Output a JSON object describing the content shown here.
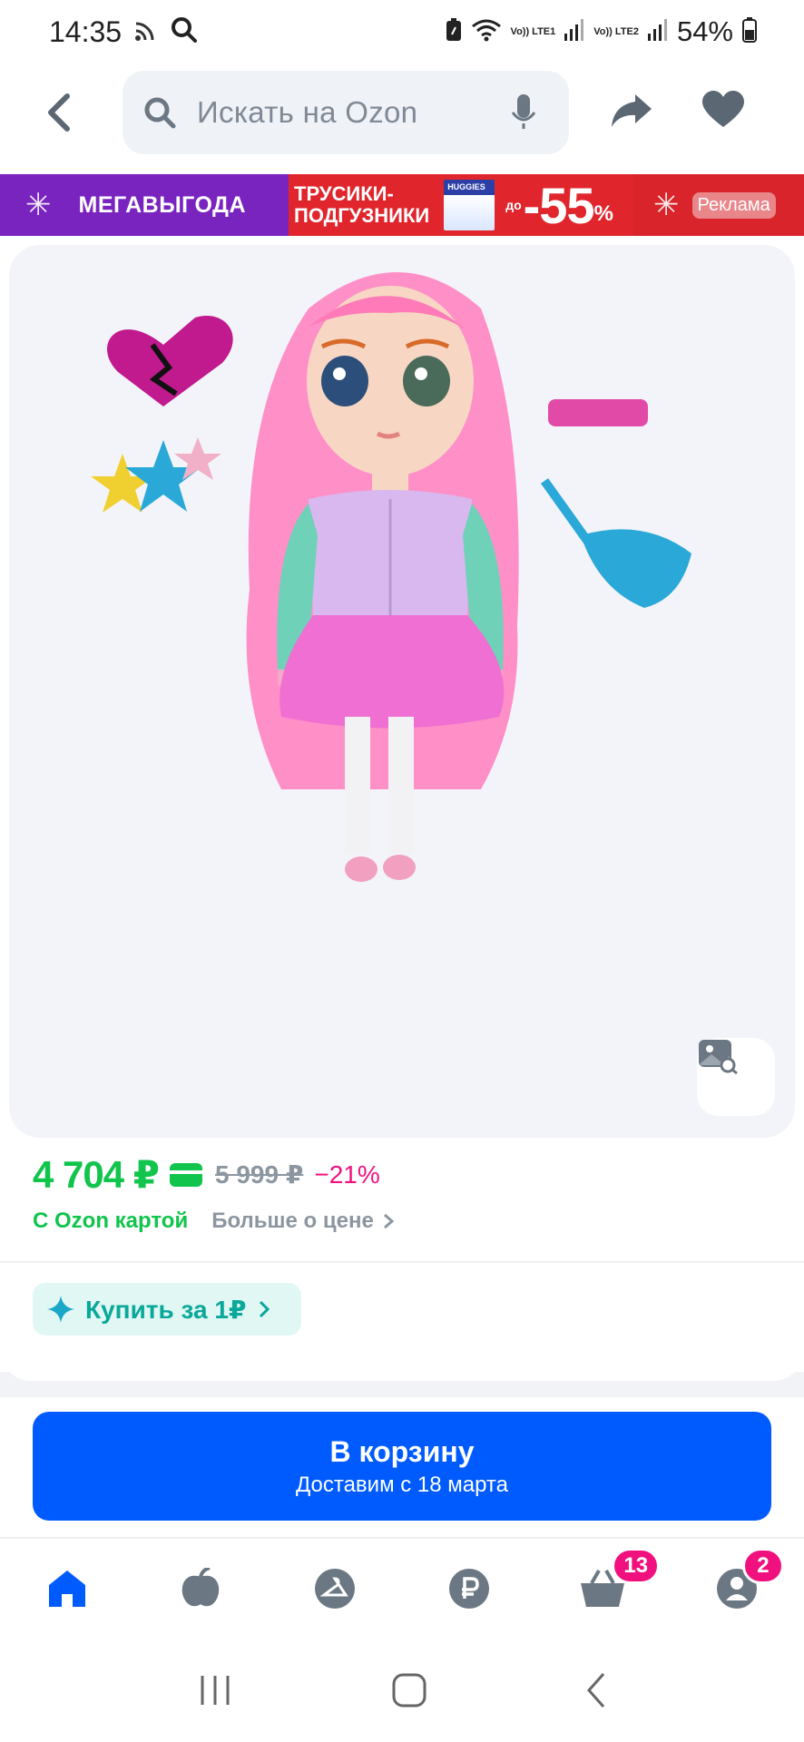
{
  "status_bar": {
    "time": "14:35",
    "battery": "54%",
    "sim1": "Vo)) LTE1",
    "sim2": "Vo)) LTE2"
  },
  "header": {
    "search_placeholder": "Искать на Ozon"
  },
  "banner": {
    "title": "МЕГАВЫГОДА",
    "product_line1": "ТРУСИКИ-",
    "product_line2": "ПОДГУЗНИКИ",
    "pack_brand": "HUGGIES",
    "prefix": "до",
    "discount": "-55",
    "percent": "%",
    "ad_label": "Реклама"
  },
  "price": {
    "current": "4 704 ₽",
    "old": "5 999 ₽",
    "discount": "−21%",
    "card_note": "С Ozon картой",
    "more_link": "Больше о цене"
  },
  "promo": {
    "buy_for_1": "Купить за 1₽"
  },
  "cart_button": {
    "title": "В корзину",
    "subtitle": "Доставим с 18 марта"
  },
  "bottom_nav": {
    "items": [
      "home-icon",
      "fresh-icon",
      "hanger-icon",
      "ruble-icon",
      "basket-icon",
      "profile-icon"
    ],
    "basket_badge": "13",
    "profile_badge": "2"
  },
  "colors": {
    "accent_blue": "#005bff",
    "price_green": "#10c44c",
    "discount_pink": "#f1117e"
  }
}
